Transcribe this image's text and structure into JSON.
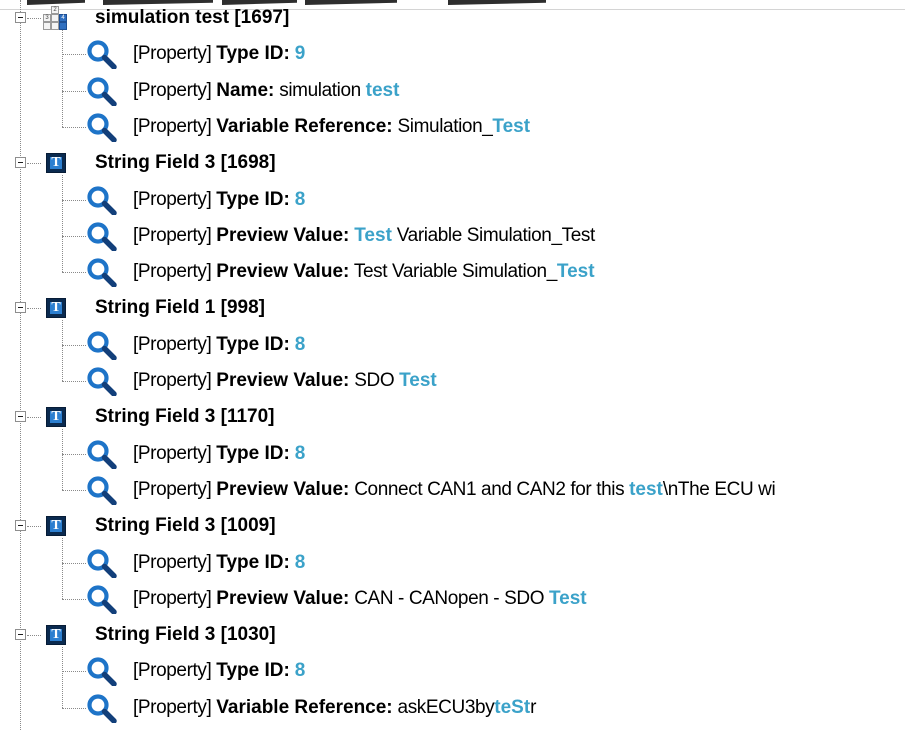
{
  "colors": {
    "highlight": "#3ba2c9",
    "icon_dark": "#0a2a4f",
    "icon_blue": "#2c7fd0",
    "connector": "#8a8a8a"
  },
  "icons": {
    "string_field": "t-icon",
    "simulation": "grid-icon",
    "property": "magnifier-icon",
    "toggle": "collapse-box-icon"
  },
  "grid_icon_labels": {
    "top": "2",
    "left": "3",
    "right": "4"
  },
  "nodes": [
    {
      "label": "simulation test [1697]",
      "icon": "simulation",
      "properties": [
        {
          "prefix": "[Property]",
          "key": "Type ID:",
          "value_plain": "",
          "value_hl": "9",
          "value_tail": ""
        },
        {
          "prefix": "[Property]",
          "key": "Name:",
          "value_plain": "simulation ",
          "value_hl": "test",
          "value_tail": ""
        },
        {
          "prefix": "[Property]",
          "key": "Variable Reference:",
          "value_plain": "Simulation_",
          "value_hl": "Test",
          "value_tail": ""
        }
      ]
    },
    {
      "label": "String Field 3 [1698]",
      "icon": "string_field",
      "properties": [
        {
          "prefix": "[Property]",
          "key": "Type ID:",
          "value_plain": "",
          "value_hl": "8",
          "value_tail": ""
        },
        {
          "prefix": "[Property]",
          "key": "Preview Value:",
          "value_plain": "",
          "value_hl": "Test",
          "value_tail": " Variable Simulation_Test"
        },
        {
          "prefix": "[Property]",
          "key": "Preview Value:",
          "value_plain": "Test Variable Simulation_",
          "value_hl": "Test",
          "value_tail": ""
        }
      ]
    },
    {
      "label": "String Field 1 [998]",
      "icon": "string_field",
      "properties": [
        {
          "prefix": "[Property]",
          "key": "Type ID:",
          "value_plain": "",
          "value_hl": "8",
          "value_tail": ""
        },
        {
          "prefix": "[Property]",
          "key": "Preview Value:",
          "value_plain": "SDO ",
          "value_hl": "Test",
          "value_tail": ""
        }
      ]
    },
    {
      "label": "String Field 3 [1170]",
      "icon": "string_field",
      "properties": [
        {
          "prefix": "[Property]",
          "key": "Type ID:",
          "value_plain": "",
          "value_hl": "8",
          "value_tail": ""
        },
        {
          "prefix": "[Property]",
          "key": "Preview Value:",
          "value_plain": "Connect CAN1 and CAN2 for this ",
          "value_hl": "test",
          "value_tail": "\\nThe ECU wi"
        }
      ]
    },
    {
      "label": "String Field 3 [1009]",
      "icon": "string_field",
      "properties": [
        {
          "prefix": "[Property]",
          "key": "Type ID:",
          "value_plain": "",
          "value_hl": "8",
          "value_tail": ""
        },
        {
          "prefix": "[Property]",
          "key": "Preview Value:",
          "value_plain": "CAN - CANopen - SDO ",
          "value_hl": "Test",
          "value_tail": ""
        }
      ]
    },
    {
      "label": "String Field 3 [1030]",
      "icon": "string_field",
      "properties": [
        {
          "prefix": "[Property]",
          "key": "Type ID:",
          "value_plain": "",
          "value_hl": "8",
          "value_tail": ""
        },
        {
          "prefix": "[Property]",
          "key": "Variable Reference:",
          "value_plain": "askECU3by",
          "value_hl": "teSt",
          "value_tail": "r"
        }
      ]
    }
  ]
}
